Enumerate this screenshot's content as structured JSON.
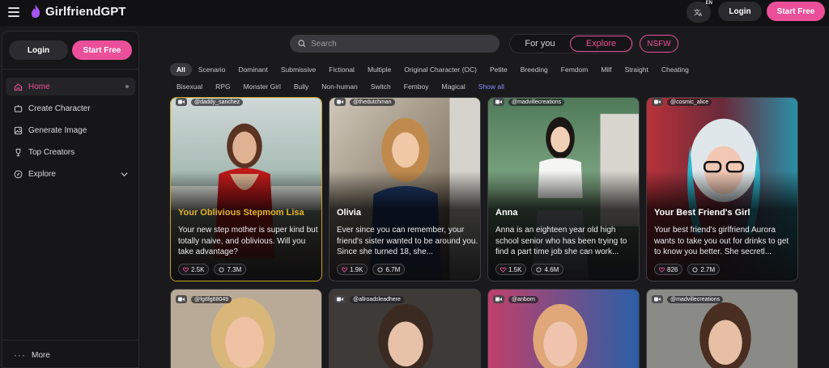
{
  "app": {
    "brand": "GirlfriendGPT",
    "accent": "#ec4f9a",
    "lang_badge": "EN"
  },
  "topbar": {
    "login_label": "Login",
    "start_label": "Start Free"
  },
  "sidebar": {
    "login_label": "Login",
    "start_label": "Start Free",
    "items": [
      {
        "label": "Home",
        "icon": "home-icon"
      },
      {
        "label": "Create Character",
        "icon": "create-icon"
      },
      {
        "label": "Generate Image",
        "icon": "image-icon"
      },
      {
        "label": "Top Creators",
        "icon": "trophy-icon"
      },
      {
        "label": "Explore",
        "icon": "compass-icon"
      }
    ],
    "more_label": "More"
  },
  "search": {
    "placeholder": "Search"
  },
  "modes": {
    "for_you": "For you",
    "explore": "Explore",
    "nsfw": "NSFW"
  },
  "tags_row1": [
    "All",
    "Scenario",
    "Dominant",
    "Submissive",
    "Fictional",
    "Multiple",
    "Original Character (OC)",
    "Petite",
    "Breeding",
    "Femdom",
    "Milf",
    "Straight",
    "Cheating"
  ],
  "tags_row2": [
    "Bisexual",
    "RPG",
    "Monster Girl",
    "Bully",
    "Non-human",
    "Switch",
    "Femboy",
    "Magical"
  ],
  "show_all": "Show all",
  "cards": [
    {
      "creator": "@daddy_sanchez",
      "name": "Your Oblivious Stepmom Lisa",
      "desc": "Your new step mother is super kind but totally naive, and oblivious. Will you take advantage?",
      "likes": "2.5K",
      "chats": "7.3M"
    },
    {
      "creator": "@thedutchman",
      "name": "Olivia",
      "desc": "Ever since you can remember, your friend's sister wanted to be around you. Since she turned 18, she...",
      "likes": "1.9K",
      "chats": "6.7M"
    },
    {
      "creator": "@madvillecreations",
      "name": "Anna",
      "desc": "Anna is an eighteen year old high school senior who has been trying to find a part time job she can work...",
      "likes": "1.5K",
      "chats": "4.6M"
    },
    {
      "creator": "@cosmic_alice",
      "name": "Your Best Friend's Girl",
      "desc": "Your best friend's girlfriend Aurora wants to take you out for drinks to get to know you better. She secretl...",
      "likes": "826",
      "chats": "2.7M"
    },
    {
      "creator": "@fg8fg88049"
    },
    {
      "creator": "@allroadsleadhere"
    },
    {
      "creator": "@anborn"
    },
    {
      "creator": "@madvillecreations"
    }
  ]
}
